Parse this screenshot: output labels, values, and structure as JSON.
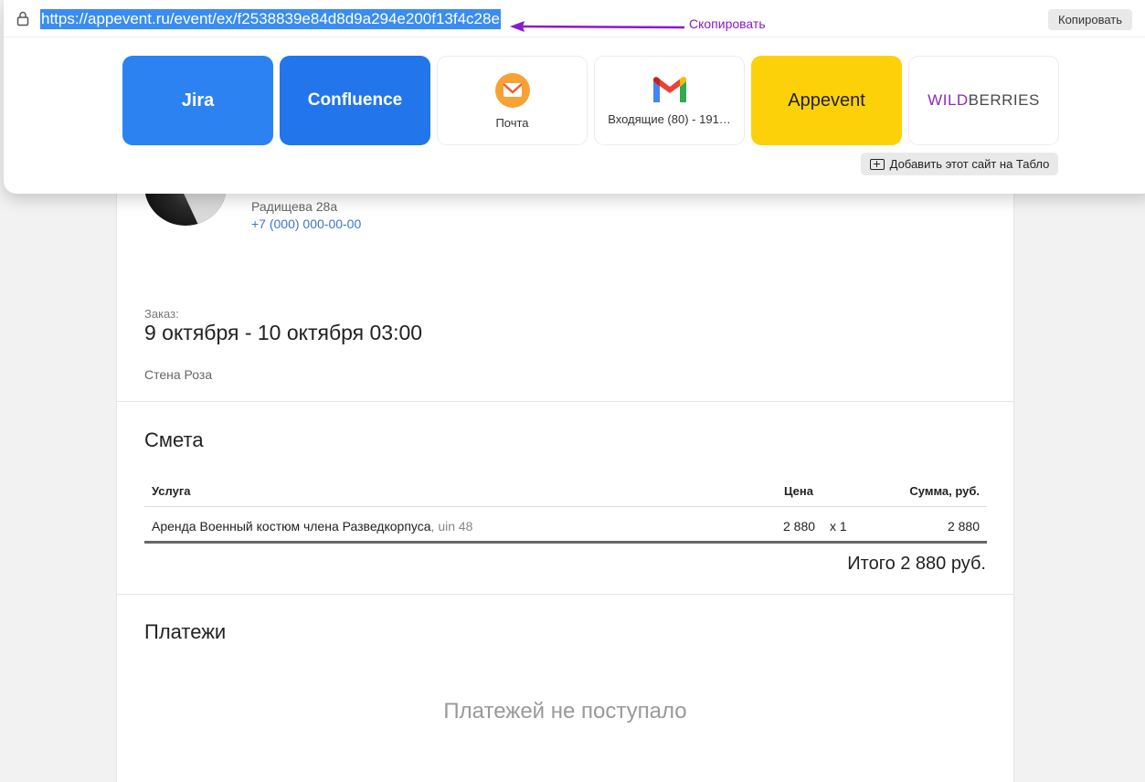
{
  "popup": {
    "url": "https://appevent.ru/event/ex/f2538839e84d8d9a294e200f13f4c28e",
    "annotation": "Скопировать",
    "copy_button": "Копировать",
    "tiles": [
      {
        "label": "Jira",
        "icon": "jira-tile",
        "color": "#2d82f2"
      },
      {
        "label": "Confluence",
        "icon": "confluence-tile",
        "color": "#2275eb"
      },
      {
        "label": "Почта",
        "icon": "mail-icon"
      },
      {
        "label": "Входящие (80) - 191…",
        "icon": "gmail-icon"
      },
      {
        "label": "Appevent",
        "icon": "appevent-tile",
        "color": "#fdd10a"
      },
      {
        "label_part1": "WILD",
        "label_part2": "BERRIES",
        "icon": "wildberries-logo"
      }
    ],
    "add_site": "Добавить этот сайт на Табло"
  },
  "profile": {
    "address": "Радищева 28а",
    "phone": "+7 (000) 000-00-00"
  },
  "order": {
    "label": "Заказ:",
    "date": "9 октября - 10 октября 03:00",
    "place": "Стена Роза"
  },
  "estimate": {
    "title": "Смета",
    "columns": {
      "service": "Услуга",
      "price": "Цена",
      "sum": "Сумма, руб."
    },
    "rows": [
      {
        "service": "Аренда Военный костюм члена Разведкорпуса",
        "uin": ", uin 48",
        "price": "2 880",
        "qty": "x 1",
        "sum": "2 880"
      }
    ],
    "total": "Итого 2 880 руб."
  },
  "payments": {
    "title": "Платежи",
    "empty": "Платежей не поступало"
  }
}
